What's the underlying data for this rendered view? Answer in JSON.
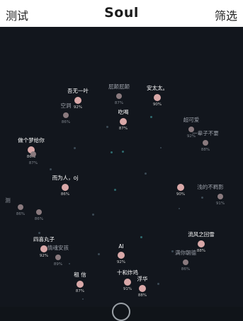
{
  "header": {
    "left": "测试",
    "title": "Soul",
    "right": "筛选"
  },
  "users": [
    {
      "name": "吾无一叶",
      "pct": "92%"
    },
    {
      "name": "屁颠屁颠",
      "pct": "87%"
    },
    {
      "name": "安太太。",
      "pct": "90%"
    },
    {
      "name": "空洞",
      "pct": "86%"
    },
    {
      "name": "吃喝",
      "pct": "87%"
    },
    {
      "name": "超可爱",
      "pct": "92%"
    },
    {
      "name": "一辈子不要",
      "pct": "88%"
    },
    {
      "name": "做个梦给你",
      "pct": "86%"
    },
    {
      "name": "",
      "pct": "87%"
    },
    {
      "name": "而为人，oj",
      "pct": "86%"
    },
    {
      "name": "",
      "pct": "90%"
    },
    {
      "name": "浅的不羁影",
      "pct": "91%"
    },
    {
      "name": "测",
      "pct": "86%"
    },
    {
      "name": "",
      "pct": "86%"
    },
    {
      "name": "四喜丸子",
      "pct": "92%"
    },
    {
      "name": "情魂安孩",
      "pct": "89%"
    },
    {
      "name": "AI",
      "pct": "92%"
    },
    {
      "name": "流风之回雪",
      "pct": "88%"
    },
    {
      "name": "满你朝德",
      "pct": "86%"
    },
    {
      "name": "十和炸鸡",
      "pct": "91%"
    },
    {
      "name": "租 信",
      "pct": "87%"
    },
    {
      "name": "浮华",
      "pct": "88%"
    }
  ]
}
